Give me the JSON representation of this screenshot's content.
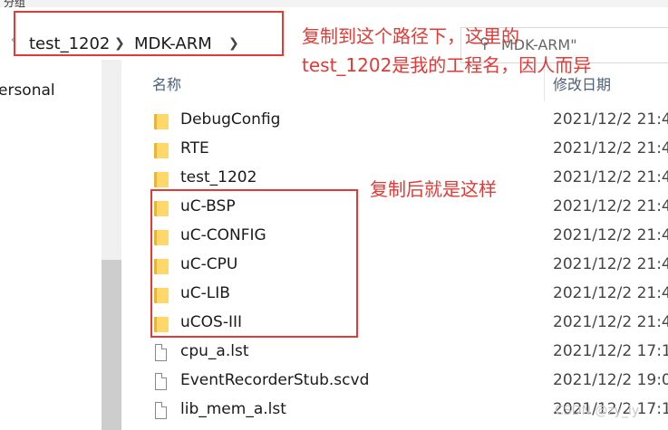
{
  "window": {
    "top_fragment": "分组"
  },
  "address_bar": {
    "breadcrumbs": [
      "test_1202",
      "MDK-ARM"
    ],
    "search_placeholder": "MDK-ARM\""
  },
  "nav_pane": {
    "items": [
      "ersonal"
    ]
  },
  "columns": {
    "name": "名称",
    "modified": "修改日期"
  },
  "files": [
    {
      "name": "DebugConfig",
      "type": "folder",
      "modified": "2021/12/2 21:4"
    },
    {
      "name": "RTE",
      "type": "folder",
      "modified": "2021/12/2 21:4"
    },
    {
      "name": "test_1202",
      "type": "folder",
      "modified": "2021/12/2 21:4"
    },
    {
      "name": "uC-BSP",
      "type": "folder",
      "modified": "2021/12/2 21:4"
    },
    {
      "name": "uC-CONFIG",
      "type": "folder",
      "modified": "2021/12/2 21:4"
    },
    {
      "name": "uC-CPU",
      "type": "folder",
      "modified": "2021/12/2 21:4"
    },
    {
      "name": "uC-LIB",
      "type": "folder",
      "modified": "2021/12/2 21:4"
    },
    {
      "name": "uCOS-III",
      "type": "folder",
      "modified": "2021/12/2 21:4"
    },
    {
      "name": "cpu_a.lst",
      "type": "file",
      "modified": "2021/12/2 17:1"
    },
    {
      "name": "EventRecorderStub.scvd",
      "type": "file",
      "modified": "2021/12/2 19:0"
    },
    {
      "name": "lib_mem_a.lst",
      "type": "file",
      "modified": "2021/12/2 17:1"
    }
  ],
  "annotations": {
    "note1_line1": "复制到这个路径下，这里的",
    "note1_line2": "test_1202是我的工程名，因人而异",
    "note2": "复制后就是这样"
  },
  "watermark": "CSDN @zy_ly",
  "colors": {
    "annotation_red": "#e53935",
    "folder": "#ffd869",
    "header_text": "#4c607a"
  }
}
